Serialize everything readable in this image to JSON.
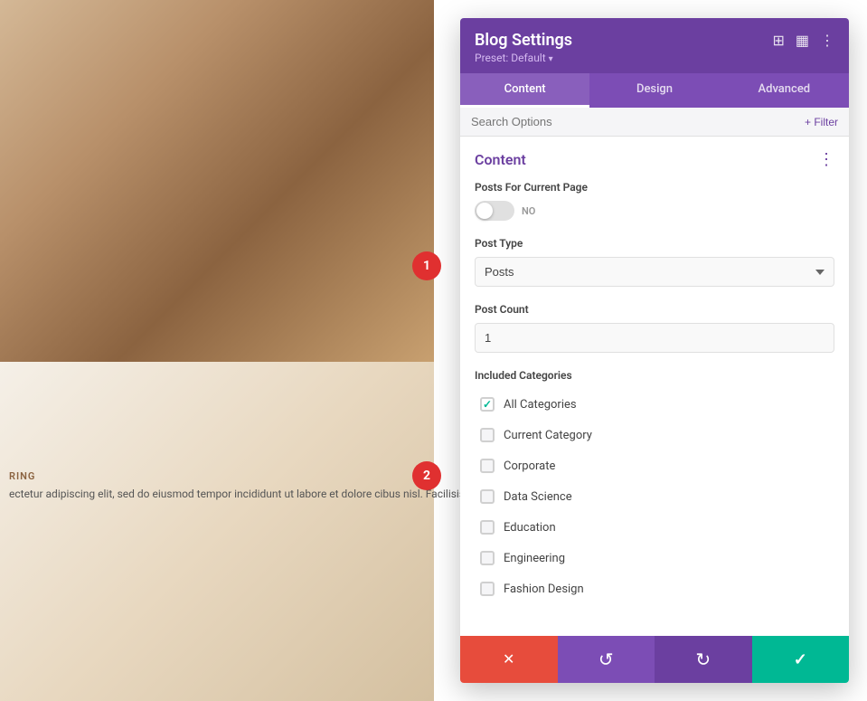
{
  "panel": {
    "title": "Blog Settings",
    "preset_label": "Preset: Default",
    "preset_arrow": "▾",
    "tabs": [
      {
        "label": "Content",
        "active": true
      },
      {
        "label": "Design",
        "active": false
      },
      {
        "label": "Advanced",
        "active": false
      }
    ],
    "search_placeholder": "Search Options",
    "filter_label": "+ Filter",
    "section_title": "Content",
    "fields": {
      "posts_current_page_label": "Posts For Current Page",
      "toggle_label": "NO",
      "post_type_label": "Post Type",
      "post_type_value": "Posts",
      "post_count_label": "Post Count",
      "post_count_value": "1",
      "included_categories_label": "Included Categories"
    },
    "categories": [
      {
        "name": "All Categories",
        "checked": true
      },
      {
        "name": "Current Category",
        "checked": false
      },
      {
        "name": "Corporate",
        "checked": false
      },
      {
        "name": "Data Science",
        "checked": false
      },
      {
        "name": "Education",
        "checked": false
      },
      {
        "name": "Engineering",
        "checked": false
      },
      {
        "name": "Fashion Design",
        "checked": false
      }
    ],
    "toolbar": {
      "cancel_icon": "✕",
      "undo_icon": "↺",
      "redo_icon": "↻",
      "save_icon": "✓"
    }
  },
  "steps": [
    {
      "number": "1"
    },
    {
      "number": "2"
    }
  ],
  "left_content": {
    "tag": "RING",
    "body": "ectetur adipiscing elit, sed do eiusmod tempor incididunt ut labore et dolore\ncibus nisl. Facilisis volutpat est velit egestas dui id. Sem et..."
  }
}
